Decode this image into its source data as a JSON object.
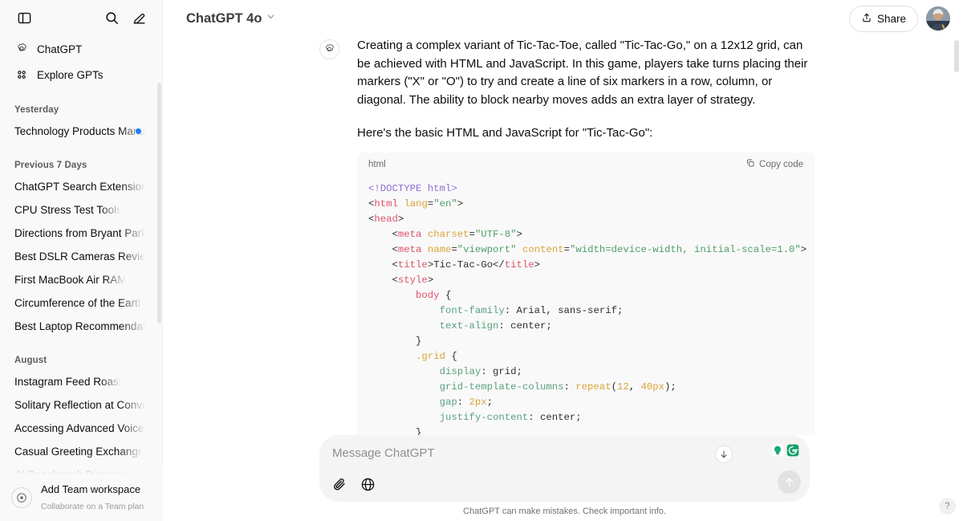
{
  "sidebar": {
    "top_icons": [
      {
        "name": "toggle-sidebar-icon",
        "label": "Toggle sidebar"
      },
      {
        "name": "search-icon",
        "label": "Search chats"
      },
      {
        "name": "new-chat-icon",
        "label": "New chat"
      }
    ],
    "nav": [
      {
        "label": "ChatGPT",
        "icon": "openai-logo-icon"
      },
      {
        "label": "Explore GPTs",
        "icon": "grid-dots-icon"
      }
    ],
    "sections": [
      {
        "title": "Yesterday",
        "items": [
          {
            "label": "Technology Products Manufac",
            "badge": true
          }
        ]
      },
      {
        "title": "Previous 7 Days",
        "items": [
          {
            "label": "ChatGPT Search Extension Info",
            "badge": false
          },
          {
            "label": "CPU Stress Test Tools",
            "badge": false
          },
          {
            "label": "Directions from Bryant Park to D",
            "badge": false
          },
          {
            "label": "Best DSLR Cameras Reviewed",
            "badge": false
          },
          {
            "label": "First MacBook Air RAM",
            "badge": false
          },
          {
            "label": "Circumference of the Earth",
            "badge": false
          },
          {
            "label": "Best Laptop Recommendations",
            "badge": false
          }
        ]
      },
      {
        "title": "August",
        "items": [
          {
            "label": "Instagram Feed Roast",
            "badge": false
          },
          {
            "label": "Solitary Reflection at Conventio",
            "badge": false
          },
          {
            "label": "Accessing Advanced Voice Feat",
            "badge": false
          },
          {
            "label": "Casual Greeting Exchange",
            "badge": false
          },
          {
            "label": "AI Benchmark Discussion",
            "badge": false
          }
        ]
      }
    ],
    "footer": {
      "icon": "team-workspace-icon",
      "title": "Add Team workspace",
      "subtitle": "Collaborate on a Team plan"
    }
  },
  "topbar": {
    "model": "ChatGPT 4o",
    "model_chevron": "chevron-down-icon",
    "share_label": "Share",
    "share_icon": "share-upload-icon",
    "avatar": "user-avatar"
  },
  "message": {
    "avatar_icon": "openai-logo-icon",
    "paragraphs": [
      "Creating a complex variant of Tic-Tac-Toe, called \"Tic-Tac-Go,\" on a 12x12 grid, can be achieved with HTML and JavaScript. In this game, players take turns placing their markers (\"X\" or \"O\") to try and create a line of six markers in a row, column, or diagonal. The ability to block nearby moves adds an extra layer of strategy.",
      "Here's the basic HTML and JavaScript for \"Tic-Tac-Go\":"
    ]
  },
  "codeblock": {
    "language": "html",
    "copy_label": "Copy code",
    "copy_icon": "copy-icon",
    "lines": [
      [
        {
          "t": "doc",
          "s": "<!DOCTYPE "
        },
        {
          "t": "doc",
          "s": "html"
        },
        {
          "t": "doc",
          "s": ">"
        }
      ],
      [
        {
          "t": "pln",
          "s": "<"
        },
        {
          "t": "tag",
          "s": "html"
        },
        {
          "t": "pln",
          "s": " "
        },
        {
          "t": "attr",
          "s": "lang"
        },
        {
          "t": "pln",
          "s": "="
        },
        {
          "t": "str",
          "s": "\"en\""
        },
        {
          "t": "pln",
          "s": ">"
        }
      ],
      [
        {
          "t": "pln",
          "s": "<"
        },
        {
          "t": "tag",
          "s": "head"
        },
        {
          "t": "pln",
          "s": ">"
        }
      ],
      [
        {
          "t": "pln",
          "s": "    <"
        },
        {
          "t": "tag",
          "s": "meta"
        },
        {
          "t": "pln",
          "s": " "
        },
        {
          "t": "attr",
          "s": "charset"
        },
        {
          "t": "pln",
          "s": "="
        },
        {
          "t": "str",
          "s": "\"UTF-8\""
        },
        {
          "t": "pln",
          "s": ">"
        }
      ],
      [
        {
          "t": "pln",
          "s": "    <"
        },
        {
          "t": "tag",
          "s": "meta"
        },
        {
          "t": "pln",
          "s": " "
        },
        {
          "t": "attr",
          "s": "name"
        },
        {
          "t": "pln",
          "s": "="
        },
        {
          "t": "str",
          "s": "\"viewport\""
        },
        {
          "t": "pln",
          "s": " "
        },
        {
          "t": "attr",
          "s": "content"
        },
        {
          "t": "pln",
          "s": "="
        },
        {
          "t": "str",
          "s": "\"width=device-width, initial-scale=1.0\""
        },
        {
          "t": "pln",
          "s": ">"
        }
      ],
      [
        {
          "t": "pln",
          "s": "    <"
        },
        {
          "t": "tag",
          "s": "title"
        },
        {
          "t": "pln",
          "s": ">Tic-Tac-Go</"
        },
        {
          "t": "tag",
          "s": "title"
        },
        {
          "t": "pln",
          "s": ">"
        }
      ],
      [
        {
          "t": "pln",
          "s": "    <"
        },
        {
          "t": "tag",
          "s": "style"
        },
        {
          "t": "pln",
          "s": ">"
        }
      ],
      [
        {
          "t": "pln",
          "s": "        "
        },
        {
          "t": "tag",
          "s": "body"
        },
        {
          "t": "pln",
          "s": " {"
        }
      ],
      [
        {
          "t": "pln",
          "s": "            "
        },
        {
          "t": "prop",
          "s": "font-family"
        },
        {
          "t": "pln",
          "s": ": Arial, sans-serif;"
        }
      ],
      [
        {
          "t": "pln",
          "s": "            "
        },
        {
          "t": "prop",
          "s": "text-align"
        },
        {
          "t": "pln",
          "s": ": center;"
        }
      ],
      [
        {
          "t": "pln",
          "s": "        }"
        }
      ],
      [
        {
          "t": "pln",
          "s": "        "
        },
        {
          "t": "fn",
          "s": ".grid"
        },
        {
          "t": "pln",
          "s": " {"
        }
      ],
      [
        {
          "t": "pln",
          "s": "            "
        },
        {
          "t": "prop",
          "s": "display"
        },
        {
          "t": "pln",
          "s": ": grid;"
        }
      ],
      [
        {
          "t": "pln",
          "s": "            "
        },
        {
          "t": "prop",
          "s": "grid-template-columns"
        },
        {
          "t": "pln",
          "s": ": "
        },
        {
          "t": "fn",
          "s": "repeat"
        },
        {
          "t": "pln",
          "s": "("
        },
        {
          "t": "num",
          "s": "12"
        },
        {
          "t": "pln",
          "s": ", "
        },
        {
          "t": "num",
          "s": "40px"
        },
        {
          "t": "pln",
          "s": ");"
        }
      ],
      [
        {
          "t": "pln",
          "s": "            "
        },
        {
          "t": "prop",
          "s": "gap"
        },
        {
          "t": "pln",
          "s": ": "
        },
        {
          "t": "num",
          "s": "2px"
        },
        {
          "t": "pln",
          "s": ";"
        }
      ],
      [
        {
          "t": "pln",
          "s": "            "
        },
        {
          "t": "prop",
          "s": "justify-content"
        },
        {
          "t": "pln",
          "s": ": center;"
        }
      ],
      [
        {
          "t": "pln",
          "s": "        }"
        }
      ]
    ]
  },
  "composer": {
    "placeholder": "Message ChatGPT",
    "value": "",
    "attach_icon": "paperclip-icon",
    "browse_icon": "globe-icon",
    "extensions": [
      {
        "name": "lightbulb-badge-icon",
        "color": "#19a974"
      },
      {
        "name": "grammarly-badge-icon",
        "color": "#15a06a"
      }
    ],
    "send_icon": "send-arrow-up-icon",
    "scroll_down_icon": "arrow-down-icon"
  },
  "disclaimer": "ChatGPT can make mistakes. Check important info.",
  "help": {
    "label": "?",
    "name": "help-button"
  },
  "colors": {
    "sidebar_bg": "#f9f9f9",
    "accent_blue": "#1a7fff",
    "code_bg": "#f9f9f9",
    "composer_bg": "#f4f4f4"
  }
}
